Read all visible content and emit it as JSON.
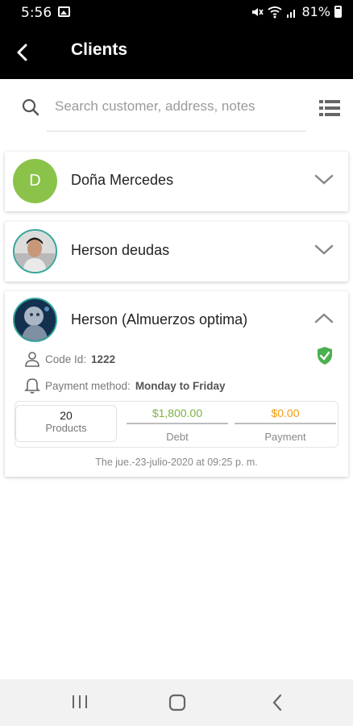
{
  "status_bar": {
    "time": "5:56",
    "battery": "81%"
  },
  "app_bar": {
    "title": "Clients"
  },
  "search": {
    "placeholder": "Search customer, address, notes"
  },
  "clients": [
    {
      "initial": "D",
      "name": "Doña Mercedes",
      "avatar_color": "#8bc34a"
    },
    {
      "name": "Herson deudas"
    },
    {
      "name": "Herson (Almuerzos optima)",
      "code_label": "Code Id:",
      "code_value": "1222",
      "payment_label": "Payment method:",
      "payment_value": "Monday to Friday",
      "products_count": "20",
      "products_label": "Products",
      "debt_value": "$1,800.00",
      "debt_label": "Debt",
      "payment_amount": "$0.00",
      "payment_amount_label": "Payment",
      "date": "The jue.-23-julio-2020 at 09:25 p. m."
    }
  ],
  "colors": {
    "debt": "#7cb342",
    "payment": "#f39c12",
    "verified": "#4caf50"
  }
}
